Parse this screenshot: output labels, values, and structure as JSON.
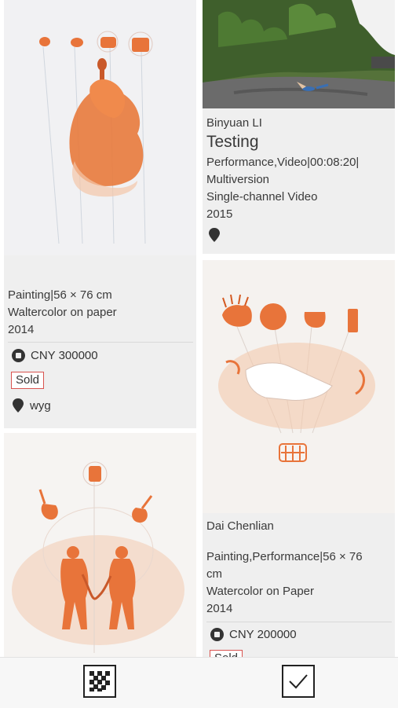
{
  "colors": {
    "card_bg": "#efefef",
    "accent_orange": "#e86a2b",
    "sold_border": "#d9534f"
  },
  "feed": {
    "left_column": [
      {
        "image_alt": "Watercolor of an orange figure playing a double bass",
        "details": [
          "Painting|56 × 76 cm",
          "Waltercolor on paper",
          "2014"
        ],
        "price": "CNY 300000",
        "status": "Sold",
        "location": "wyg"
      },
      {
        "image_alt": "Watercolor of two saxophone players in orange"
      }
    ],
    "right_column": [
      {
        "image_alt": "Photo of a performance on a dirt ground in a forest",
        "artist": "Binyuan LI",
        "title": "Testing",
        "details": [
          "Performance,Video|00:08:20|",
          "Multiversion",
          "Single-channel Video",
          "2015"
        ]
      },
      {
        "image_alt": "Watercolor with orange food and a paper sheet",
        "artist": "Dai Chenlian",
        "details": [
          "Painting,Performance|56 × 76",
          "cm",
          "Watercolor on Paper",
          "2014"
        ],
        "price": "CNY 200000",
        "status": "Sold"
      }
    ]
  },
  "bottom_bar": {
    "left_icon": "qr-code-icon",
    "right_icon": "checkmark-icon"
  }
}
